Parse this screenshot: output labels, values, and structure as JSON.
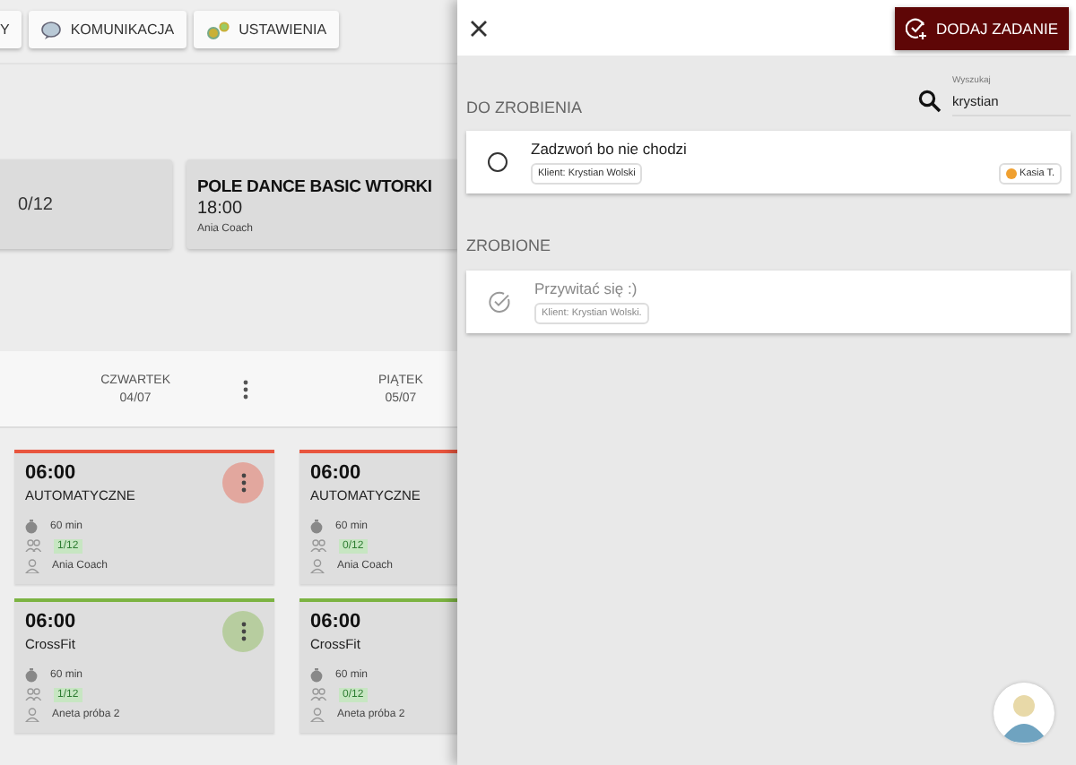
{
  "nav_buttons": [
    {
      "label": "Y",
      "kind": "plain"
    },
    {
      "label": "KOMUNIKACJA",
      "kind": "chat"
    },
    {
      "label": "USTAWIENIA",
      "kind": "gears"
    }
  ],
  "class_cards": [
    {
      "capacity": "0/12"
    },
    {
      "title": "POLE DANCE BASIC WTORKI",
      "time": "18:00",
      "coach": "Ania Coach"
    }
  ],
  "days": [
    {
      "name": "CZWARTEK",
      "date": "04/07",
      "has_menu": true,
      "events": [
        {
          "time": "06:00",
          "name": "AUTOMATYCZNE",
          "duration": "60 min",
          "capacity": "1/12",
          "coach": "Ania Coach",
          "color": "#e8553e",
          "menu": true
        },
        {
          "time": "06:00",
          "name": "CrossFit",
          "duration": "60 min",
          "capacity": "1/12",
          "coach": "Aneta próba 2",
          "color": "#7cb342",
          "menu": true
        }
      ]
    },
    {
      "name": "PIĄTEK",
      "date": "05/07",
      "events": [
        {
          "time": "06:00",
          "name": "AUTOMATYCZNE",
          "duration": "60 min",
          "capacity": "0/12",
          "coach": "Ania Coach",
          "color": "#e8553e"
        },
        {
          "time": "06:00",
          "name": "CrossFit",
          "duration": "60 min",
          "capacity": "0/12",
          "coach": "Aneta próba 2",
          "color": "#7cb342"
        }
      ]
    }
  ],
  "drawer": {
    "add_button": "DODAJ ZADANIE",
    "search": {
      "label": "Wyszukaj",
      "value": "krystian"
    },
    "sections": [
      {
        "title": "DO ZROBIENIA",
        "tasks": [
          {
            "title": "Zadzwoń bo nie chodzi",
            "client": "Klient: Krystian Wolski",
            "assignee": "Kasia T.",
            "done": false
          }
        ]
      },
      {
        "title": "ZROBIONE",
        "tasks": [
          {
            "title": "Przywitać się :)",
            "client": "Klient: Krystian Wolski.",
            "done": true
          }
        ]
      }
    ]
  }
}
